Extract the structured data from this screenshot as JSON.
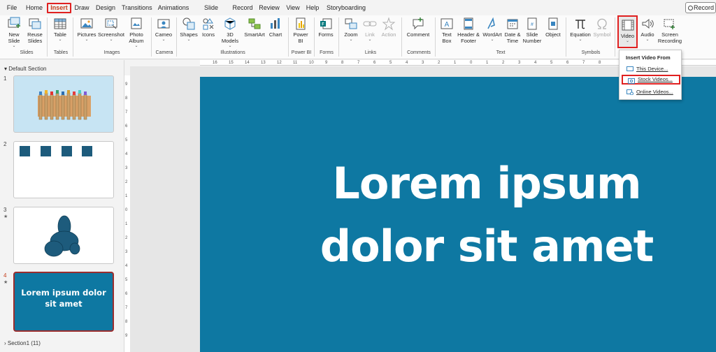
{
  "tabs": [
    {
      "label": "File"
    },
    {
      "label": "Home"
    },
    {
      "label": "Insert"
    },
    {
      "label": "Draw"
    },
    {
      "label": "Design"
    },
    {
      "label": "Transitions"
    },
    {
      "label": "Animations"
    },
    {
      "label": "Slide Show"
    },
    {
      "label": "Record"
    },
    {
      "label": "Review"
    },
    {
      "label": "View"
    },
    {
      "label": "Help"
    },
    {
      "label": "Storyboarding"
    }
  ],
  "record_button": "Record",
  "ribbon": {
    "buttons": {
      "new_slide": "New Slide",
      "reuse_slides": "Reuse Slides",
      "table": "Table",
      "pictures": "Pictures",
      "screenshot": "Screenshot",
      "photo_album": "Photo Album",
      "cameo": "Cameo",
      "shapes": "Shapes",
      "icons": "Icons",
      "models_3d": "3D Models",
      "smartart": "SmartArt",
      "chart": "Chart",
      "power_bi": "Power BI",
      "forms": "Forms",
      "zoom": "Zoom",
      "link": "Link",
      "action": "Action",
      "comment": "Comment",
      "text_box": "Text Box",
      "header_footer": "Header & Footer",
      "wordart": "WordArt",
      "date_time": "Date & Time",
      "slide_number": "Slide Number",
      "object": "Object",
      "equation": "Equation",
      "symbol": "Symbol",
      "video": "Video",
      "audio": "Audio",
      "screen_recording": "Screen Recording"
    },
    "groups": {
      "slides": "Slides",
      "tables": "Tables",
      "images": "Images",
      "camera": "Camera",
      "illustrations": "Illustrations",
      "power_bi": "Power BI",
      "forms": "Forms",
      "links": "Links",
      "comments": "Comments",
      "text": "Text",
      "symbols": "Symbols"
    }
  },
  "video_menu": {
    "header": "Insert Video From",
    "items": [
      {
        "label": "This Device..."
      },
      {
        "label": "Stock Videos..."
      },
      {
        "label": "Online Videos..."
      }
    ]
  },
  "slides_panel": {
    "section_default": "Default Section",
    "section_1": "Section1 (11)",
    "slides": [
      {
        "number": "1"
      },
      {
        "number": "2"
      },
      {
        "number": "3"
      },
      {
        "number": "4",
        "title": "Lorem ipsum dolor sit amet"
      }
    ]
  },
  "slide": {
    "title_line1": "Lorem ipsum",
    "title_line2": "dolor sit amet"
  },
  "ruler": {
    "h_ticks": [
      "16",
      "15",
      "14",
      "13",
      "12",
      "11",
      "10",
      "9",
      "8",
      "7",
      "6",
      "5",
      "4",
      "3",
      "2",
      "1",
      "0",
      "1",
      "2",
      "3",
      "4",
      "5",
      "6",
      "7",
      "8"
    ],
    "v_ticks": [
      "9",
      "8",
      "7",
      "6",
      "5",
      "4",
      "3",
      "2",
      "1",
      "0",
      "1",
      "2",
      "3",
      "4",
      "5",
      "6",
      "7",
      "8",
      "9"
    ]
  },
  "colors": {
    "accent": "#c43e1c",
    "highlight": "#e02020",
    "slide_bg": "#0e78a2",
    "thumb1_bg": "#c7e4f3",
    "shape": "#1d5b7c"
  }
}
